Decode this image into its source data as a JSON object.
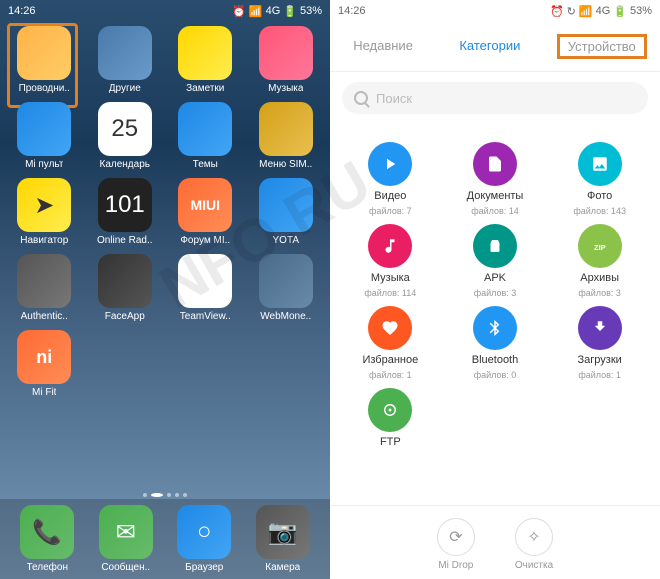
{
  "status": {
    "time": "14:26",
    "net": "4G",
    "battery": "53%"
  },
  "homeApps": [
    {
      "label": "Проводни..",
      "cls": "ic-folder"
    },
    {
      "label": "Другие",
      "cls": "ic-other"
    },
    {
      "label": "Заметки",
      "cls": "ic-notes"
    },
    {
      "label": "Музыка",
      "cls": "ic-music"
    },
    {
      "label": "Mi пульт",
      "cls": "ic-remote"
    },
    {
      "label": "Календарь",
      "cls": "ic-cal",
      "text": "25"
    },
    {
      "label": "Темы",
      "cls": "ic-themes"
    },
    {
      "label": "Меню SIM..",
      "cls": "ic-sim"
    },
    {
      "label": "Навигатор",
      "cls": "ic-nav",
      "text": "➤"
    },
    {
      "label": "Online Rad..",
      "cls": "ic-radio",
      "text": "101"
    },
    {
      "label": "Форум MI..",
      "cls": "ic-miui",
      "text": "MIUI"
    },
    {
      "label": "YOTA",
      "cls": "ic-yota"
    },
    {
      "label": "Authentic..",
      "cls": "ic-auth"
    },
    {
      "label": "FaceApp",
      "cls": "ic-face"
    },
    {
      "label": "TeamView..",
      "cls": "ic-team",
      "text": "↔"
    },
    {
      "label": "WebMone..",
      "cls": "ic-web"
    },
    {
      "label": "Mi Fit",
      "cls": "ic-mifit",
      "text": "ni"
    }
  ],
  "dock": [
    {
      "label": "Телефон",
      "cls": "ic-phone",
      "text": "📞"
    },
    {
      "label": "Сообщен..",
      "cls": "ic-msg",
      "text": "✉"
    },
    {
      "label": "Браузер",
      "cls": "ic-browser",
      "text": "○"
    },
    {
      "label": "Камера",
      "cls": "ic-camera",
      "text": "📷"
    }
  ],
  "tabs": {
    "recent": "Недавние",
    "categories": "Категории",
    "device": "Устройство"
  },
  "search": {
    "placeholder": "Поиск"
  },
  "cats": [
    {
      "label": "Видео",
      "sub": "файлов: 7",
      "cls": "c-video",
      "icon": "play"
    },
    {
      "label": "Документы",
      "sub": "файлов: 14",
      "cls": "c-doc",
      "icon": "doc"
    },
    {
      "label": "Фото",
      "sub": "файлов: 143",
      "cls": "c-photo",
      "icon": "photo"
    },
    {
      "label": "Музыка",
      "sub": "файлов: 114",
      "cls": "c-mus",
      "icon": "music"
    },
    {
      "label": "APK",
      "sub": "файлов: 3",
      "cls": "c-apk",
      "icon": "apk"
    },
    {
      "label": "Архивы",
      "sub": "файлов: 3",
      "cls": "c-zip",
      "icon": "zip"
    },
    {
      "label": "Избранное",
      "sub": "файлов: 1",
      "cls": "c-fav",
      "icon": "fav"
    },
    {
      "label": "Bluetooth",
      "sub": "файлов: 0",
      "cls": "c-bt",
      "icon": "bt"
    },
    {
      "label": "Загрузки",
      "sub": "файлов: 1",
      "cls": "c-dl",
      "icon": "dl"
    },
    {
      "label": "FTP",
      "sub": "",
      "cls": "c-ftp",
      "icon": "ftp"
    }
  ],
  "actions": {
    "midrop": "Mi Drop",
    "clean": "Очистка"
  },
  "watermark": "NFO.RU"
}
